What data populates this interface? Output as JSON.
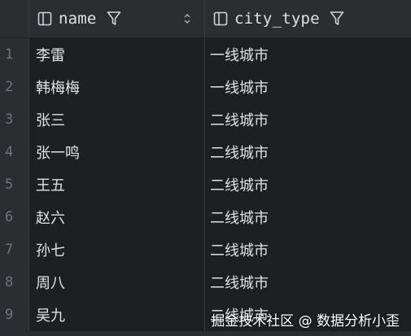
{
  "colors": {
    "background": "#2b2d30",
    "cell_background": "#1e1f22",
    "row_number": "#6f737a",
    "text": "#dfe1e5",
    "grid_line": "#393b40"
  },
  "header": {
    "columns": [
      {
        "label": "name",
        "icon": "column-icon",
        "filter_icon": "filter-icon",
        "sort_icon": "sort-icon"
      },
      {
        "label": "city_type",
        "icon": "column-icon",
        "filter_icon": "filter-icon"
      }
    ]
  },
  "rows": [
    {
      "num": "1",
      "name": "李雷",
      "city_type": "一线城市"
    },
    {
      "num": "2",
      "name": "韩梅梅",
      "city_type": "一线城市"
    },
    {
      "num": "3",
      "name": "张三",
      "city_type": "二线城市"
    },
    {
      "num": "4",
      "name": "张一鸣",
      "city_type": "二线城市"
    },
    {
      "num": "5",
      "name": "王五",
      "city_type": "二线城市"
    },
    {
      "num": "6",
      "name": "赵六",
      "city_type": "二线城市"
    },
    {
      "num": "7",
      "name": "孙七",
      "city_type": "二线城市"
    },
    {
      "num": "8",
      "name": "周八",
      "city_type": "二线城市"
    },
    {
      "num": "9",
      "name": "吴九",
      "city_type": "二线城市"
    }
  ],
  "watermark": "掘金技术社区 @ 数据分析小歪"
}
